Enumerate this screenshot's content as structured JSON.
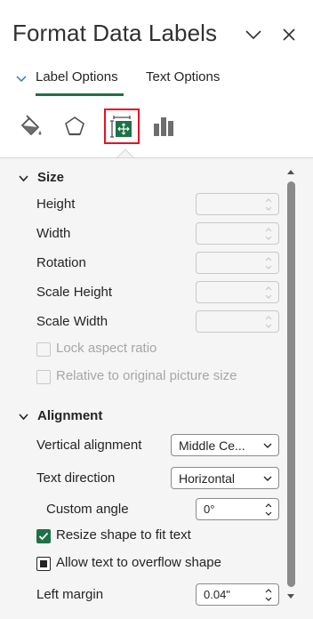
{
  "pane": {
    "title": "Format Data Labels"
  },
  "tabs": {
    "label_options": "Label Options",
    "text_options": "Text Options"
  },
  "icons": {
    "fill_line": "paint-bucket-icon",
    "effects": "pentagon-icon",
    "size_properties": "size-properties-icon",
    "label_options": "bar-chart-icon",
    "selected_highlight": "#e81123"
  },
  "size": {
    "heading": "Size",
    "height_label": "Height",
    "width_label": "Width",
    "rotation_label": "Rotation",
    "scale_height_label": "Scale Height",
    "scale_width_label": "Scale Width",
    "lock_aspect_label": "Lock aspect ratio",
    "relative_label": "Relative to original picture size"
  },
  "alignment": {
    "heading": "Alignment",
    "vertical_label": "Vertical alignment",
    "vertical_value": "Middle Ce...",
    "direction_label": "Text direction",
    "direction_value": "Horizontal",
    "custom_angle_label": "Custom angle",
    "custom_angle_value": "0°",
    "resize_label": "Resize shape to fit text",
    "overflow_label": "Allow text to overflow shape",
    "left_margin_label": "Left margin",
    "left_margin_value": "0.04\""
  },
  "colors": {
    "accent": "#1e7145",
    "panel_bg": "#f5f5f5"
  }
}
